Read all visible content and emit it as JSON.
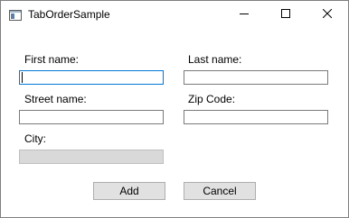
{
  "window": {
    "title": "TabOrderSample",
    "icon": "window-app-icon"
  },
  "caption_buttons": {
    "minimize": "minimize-icon",
    "maximize": "maximize-icon",
    "close": "close-icon"
  },
  "form": {
    "first_name": {
      "label": "First name:",
      "value": ""
    },
    "last_name": {
      "label": "Last name:",
      "value": ""
    },
    "street_name": {
      "label": "Street name:",
      "value": ""
    },
    "zip_code": {
      "label": "Zip Code:",
      "value": ""
    },
    "city": {
      "label": "City:",
      "value": "",
      "disabled": true
    }
  },
  "buttons": {
    "add": "Add",
    "cancel": "Cancel"
  },
  "colors": {
    "focus_border": "#0078d7",
    "disabled_field": "#d9d9d9",
    "button_face": "#e1e1e1"
  }
}
